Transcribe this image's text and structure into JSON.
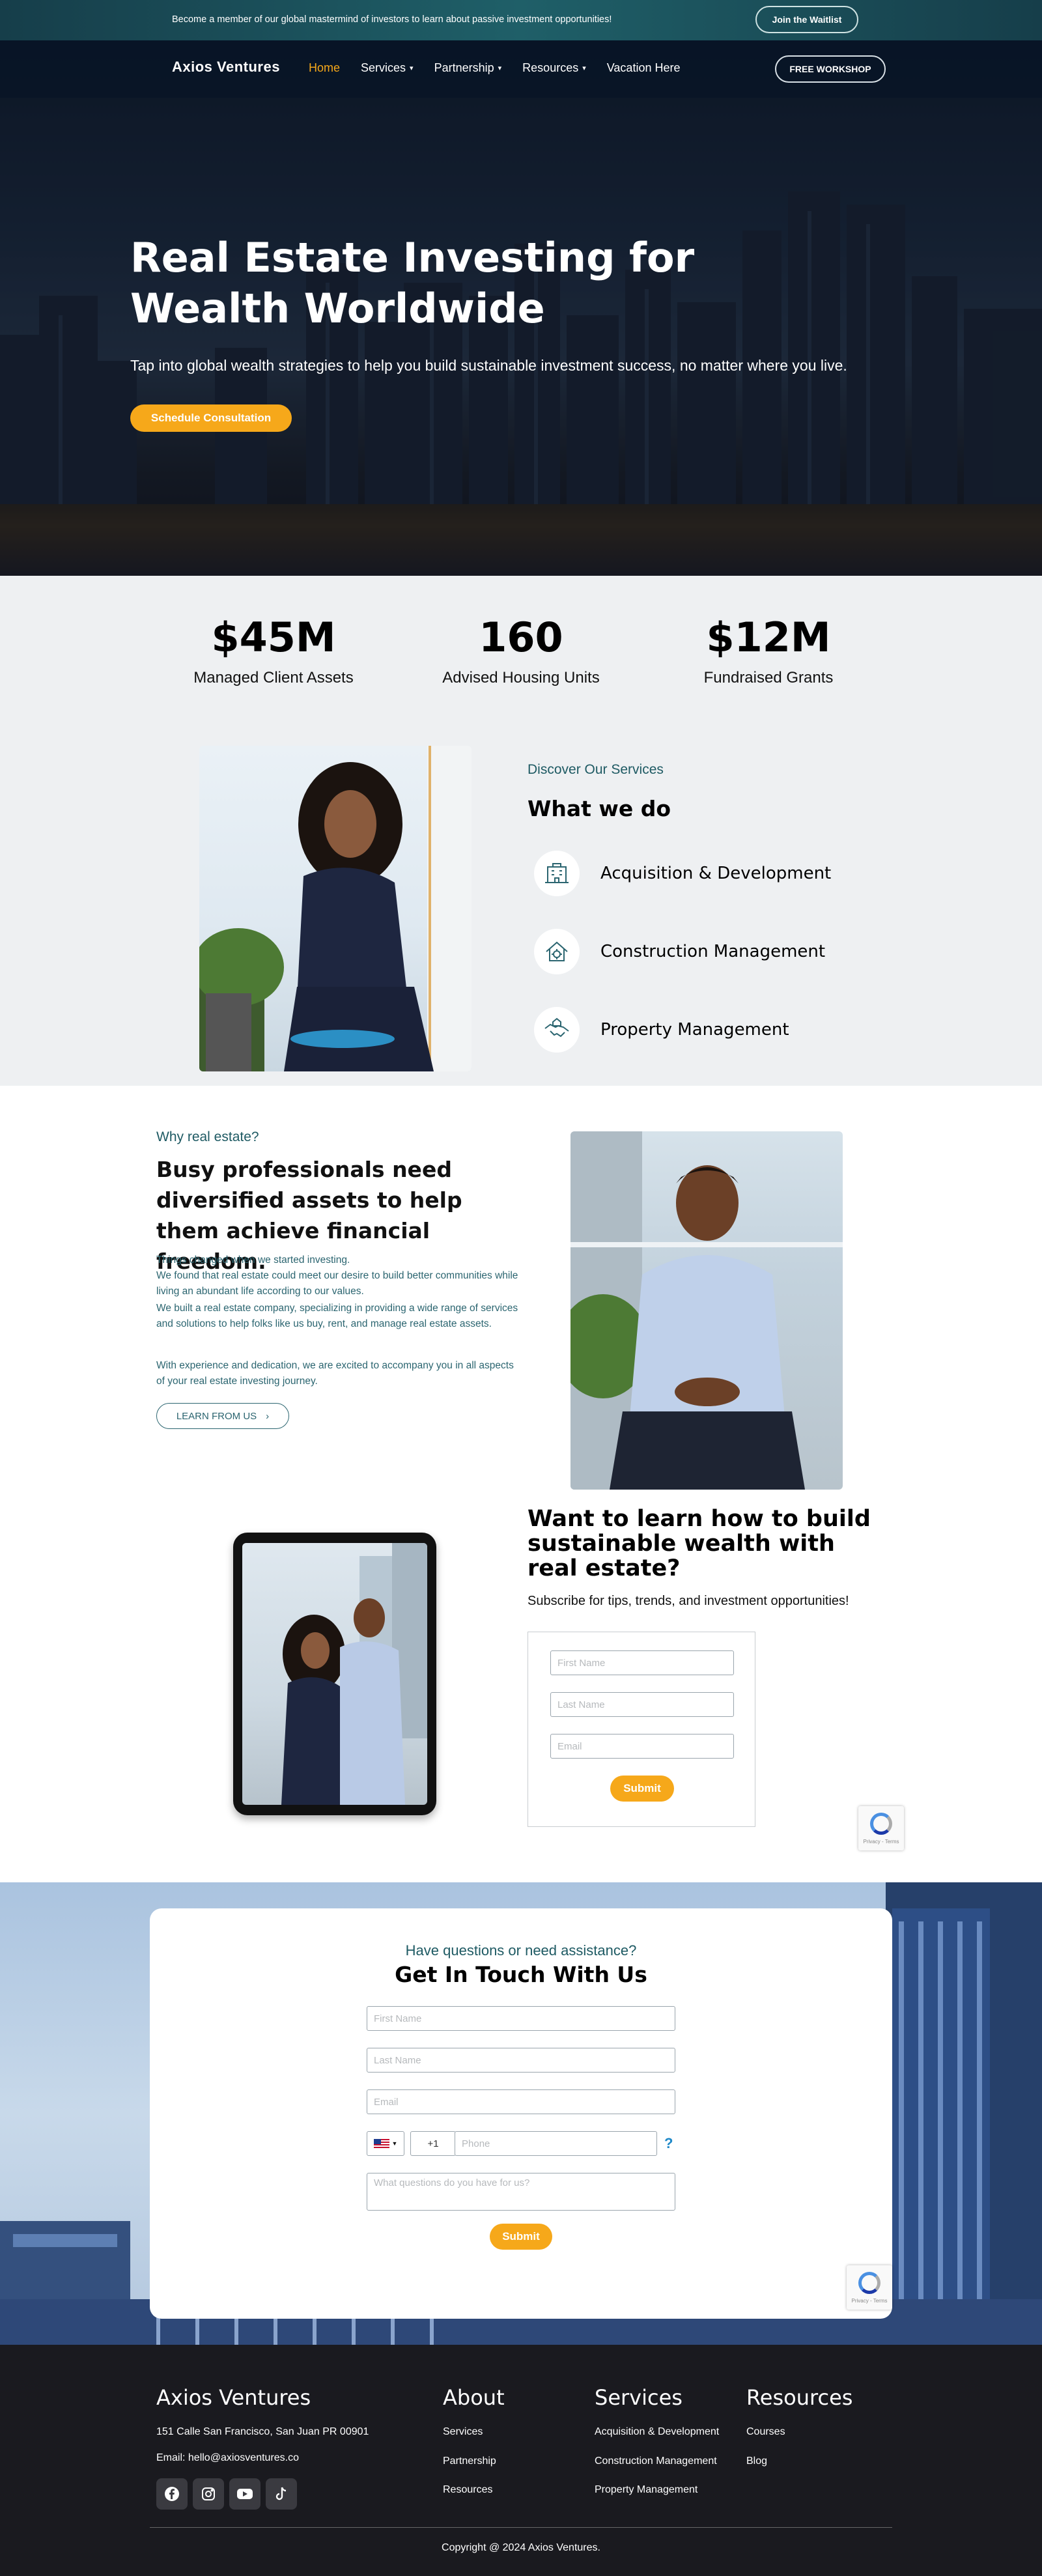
{
  "topbar": {
    "text": "Become a member of our global mastermind of investors to learn about passive investment opportunities!",
    "button": "Join the Waitlist"
  },
  "nav": {
    "logo": "Axios Ventures",
    "items": [
      {
        "label": "Home",
        "active": true,
        "dropdown": false
      },
      {
        "label": "Services",
        "dropdown": true
      },
      {
        "label": "Partnership",
        "dropdown": true
      },
      {
        "label": "Resources",
        "dropdown": true
      },
      {
        "label": "Vacation Here",
        "dropdown": false
      }
    ],
    "cta": "FREE WORKSHOP"
  },
  "hero": {
    "title": "Real Estate Investing for Wealth Worldwide",
    "subtitle": "Tap into global wealth strategies to help you build sustainable investment success, no matter where you live.",
    "button": "Schedule Consultation"
  },
  "stats": [
    {
      "value": "$45M",
      "label": "Managed Client Assets"
    },
    {
      "value": "160",
      "label": "Advised Housing Units"
    },
    {
      "value": "$12M",
      "label": "Fundraised Grants"
    }
  ],
  "services": {
    "kicker": "Discover Our Services",
    "title": "What we do",
    "items": [
      {
        "label": "Acquisition & Development",
        "icon": "building-icon"
      },
      {
        "label": "Construction Management",
        "icon": "house-gear-icon"
      },
      {
        "label": "Property Management",
        "icon": "handshake-icon"
      }
    ]
  },
  "why": {
    "kicker": "Why real estate?",
    "title": "Busy professionals need diversified assets to help them achieve financial freedom.",
    "p1": "Things changed when we started investing.",
    "p2": "We found that real estate could meet our desire to build better communities while living an abundant life according to our values.",
    "p3": "We built a real estate company, specializing in providing a wide range of services and solutions to help folks like us buy, rent, and manage real estate assets.",
    "p4": "With experience and dedication, we are excited to accompany you in all aspects of your real estate investing journey.",
    "button": "LEARN FROM US"
  },
  "subscribe": {
    "title": "Want to learn how to build sustainable wealth with real estate?",
    "text": "Subscribe for tips, trends, and investment opportunities!",
    "first_name": "First Name",
    "last_name": "Last Name",
    "email": "Email",
    "submit": "Submit"
  },
  "contact": {
    "kicker": "Have questions or need assistance?",
    "title": "Get In Touch With Us",
    "first_name": "First Name",
    "last_name": "Last Name",
    "email": "Email",
    "dial_code": "+1",
    "phone": "Phone",
    "help": "?",
    "message": "What questions do you have for us?",
    "submit": "Submit"
  },
  "recaptcha": {
    "text": "Privacy - Terms"
  },
  "footer": {
    "brand": "Axios Ventures",
    "address": "151 Calle San Francisco, San Juan PR 00901",
    "email": "Email: hello@axiosventures.co",
    "social": [
      "facebook-icon",
      "instagram-icon",
      "youtube-icon",
      "tiktok-icon"
    ],
    "about": {
      "heading": "About",
      "links": [
        "Services",
        "Partnership",
        "Resources"
      ]
    },
    "services": {
      "heading": "Services",
      "links": [
        "Acquisition & Development",
        "Construction Management",
        "Property Management"
      ]
    },
    "resources": {
      "heading": "Resources",
      "links": [
        "Courses",
        "Blog"
      ]
    },
    "copyright": "Copyright @ 2024 Axios Ventures."
  },
  "colors": {
    "accent": "#f6a81a",
    "teal": "#1e5a63",
    "footer": "#1a1a1f"
  }
}
